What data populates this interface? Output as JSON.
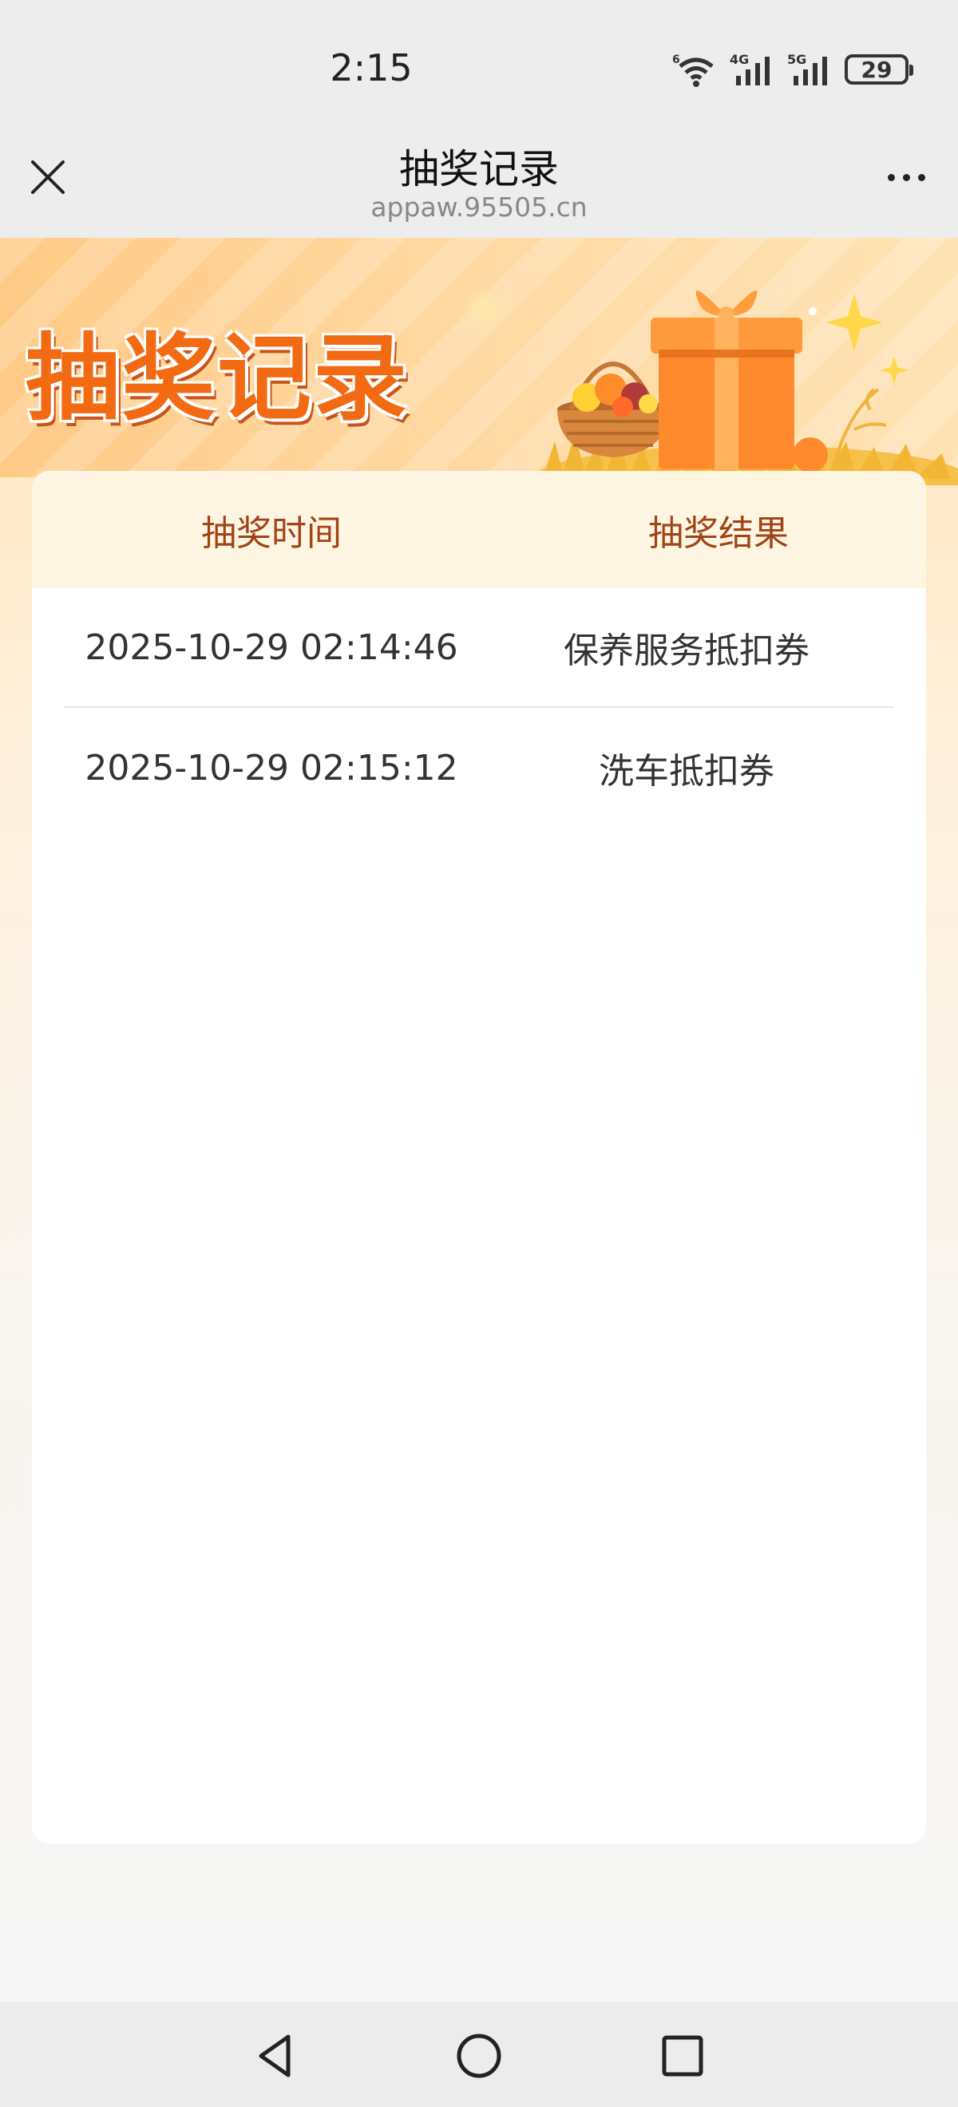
{
  "status_bar": {
    "time": "2:15",
    "network_1": "6",
    "network_2": "4G",
    "network_3": "5G",
    "battery_level": "29"
  },
  "nav": {
    "title": "抽奖记录",
    "subtitle": "appaw.95505.cn"
  },
  "banner": {
    "title": "抽奖记录"
  },
  "table": {
    "headers": {
      "time": "抽奖时间",
      "result": "抽奖结果"
    },
    "rows": [
      {
        "time": "2025-10-29 02:14:46",
        "result": "保养服务抵扣券"
      },
      {
        "time": "2025-10-29 02:15:12",
        "result": "洗车抵扣券"
      }
    ]
  },
  "colors": {
    "accent": "#f26a12",
    "header_text": "#a04416",
    "header_bg": "#fff5e3"
  }
}
